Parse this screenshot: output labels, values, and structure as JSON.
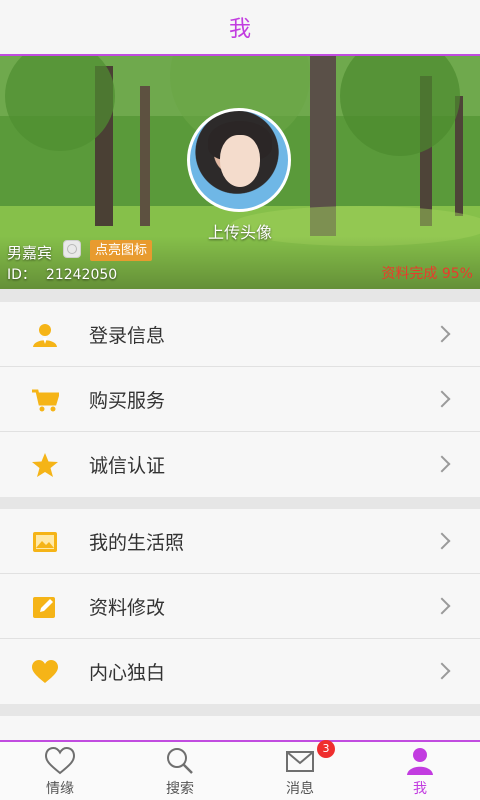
{
  "header": {
    "title": "我"
  },
  "profile": {
    "upload_label": "上传头像",
    "username": "男嘉宾",
    "light_icon_label": "点亮图标",
    "id_label": "ID：",
    "id_value": "21242050",
    "completion_text": "资料完成 95%"
  },
  "sections": [
    {
      "items": [
        {
          "label": "登录信息",
          "icon": "user-icon"
        },
        {
          "label": "购买服务",
          "icon": "cart-icon"
        },
        {
          "label": "诚信认证",
          "icon": "star-icon"
        }
      ]
    },
    {
      "items": [
        {
          "label": "我的生活照",
          "icon": "photo-icon"
        },
        {
          "label": "资料修改",
          "icon": "edit-icon"
        },
        {
          "label": "内心独白",
          "icon": "heart-icon"
        }
      ]
    }
  ],
  "tabbar": {
    "tabs": [
      {
        "label": "情缘",
        "icon": "heart-outline-icon"
      },
      {
        "label": "搜索",
        "icon": "search-icon"
      },
      {
        "label": "消息",
        "icon": "mail-icon",
        "badge": "3"
      },
      {
        "label": "我",
        "icon": "person-icon",
        "active": true
      }
    ]
  },
  "colors": {
    "accent": "#c23ce0",
    "orange": "#e89b2f",
    "completion": "#e83b2d",
    "icon_yellow": "#f5b417"
  }
}
